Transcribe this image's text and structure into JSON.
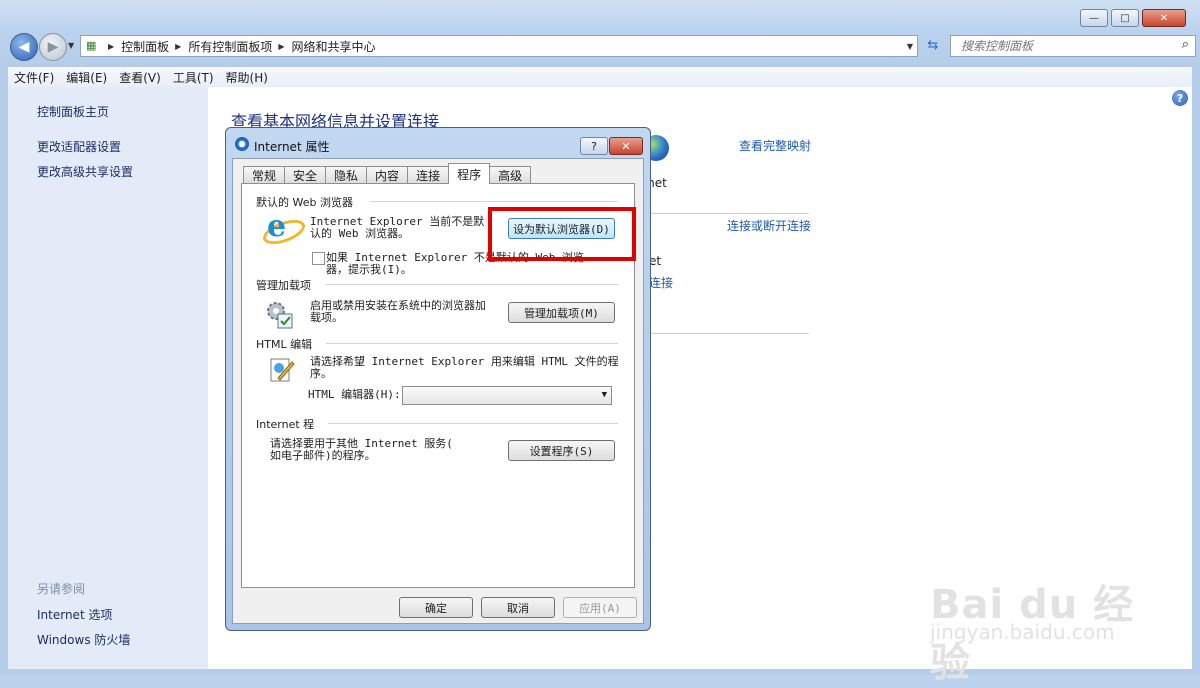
{
  "window": {
    "minimize": "—",
    "maximize": "□",
    "close": "✕"
  },
  "nav": {
    "breadcrumbs": [
      "控制面板",
      "所有控制面板项",
      "网络和共享中心"
    ],
    "search_placeholder": "搜索控制面板"
  },
  "menu": [
    "文件(F)",
    "编辑(E)",
    "查看(V)",
    "工具(T)",
    "帮助(H)"
  ],
  "sidebar": {
    "items": [
      "控制面板主页",
      "更改适配器设置",
      "更改高级共享设置"
    ],
    "see_also_title": "另请参阅",
    "see_also": [
      "Internet 选项",
      "Windows 防火墙"
    ]
  },
  "content": {
    "title": "查看基本网络信息并设置连接",
    "view_full_map": "查看完整映射",
    "internet_partial": "ernet",
    "connect_disconnect": "连接或断开连接",
    "partial_net": "et",
    "partial_link": "连接"
  },
  "dialog": {
    "title": "Internet 属性",
    "help": "?",
    "close": "✕",
    "tabs": [
      "常规",
      "安全",
      "隐私",
      "内容",
      "连接",
      "程序",
      "高级"
    ],
    "active_tab": "程序",
    "web_browser": {
      "group": "默认的 Web 浏览器",
      "text_line1": "Internet Explorer 当前不是默",
      "text_line2": "认的 Web 浏览器。",
      "button": "设为默认浏览器(D)",
      "check_line1": "如果 Internet Explorer 不是默认的 Web 浏览",
      "check_line2": "器，提示我(I)。"
    },
    "addons": {
      "group": "管理加载项",
      "text_line1": "启用或禁用安装在系统中的浏览器加",
      "text_line2": "载项。",
      "button": "管理加载项(M)"
    },
    "html_edit": {
      "group": "HTML 编辑",
      "text_line1": "请选择希望 Internet Explorer 用来编辑 HTML 文件的程",
      "text_line2": "序。",
      "editor_label": "HTML 编辑器(H):",
      "editor_value": ""
    },
    "internet_programs": {
      "group": "Internet 程",
      "text_line1": "请选择要用于其他 Internet 服务(",
      "text_line2": "如电子邮件)的程序。",
      "button": "设置程序(S)"
    },
    "ok": "确定",
    "cancel": "取消",
    "apply": "应用(A)"
  },
  "watermark": {
    "logo": "Bai du 经验",
    "url": "jingyan.baidu.com"
  },
  "colors": {
    "highlight_box": "#e00000",
    "link": "#1f5bb3",
    "title": "#1e3287"
  }
}
